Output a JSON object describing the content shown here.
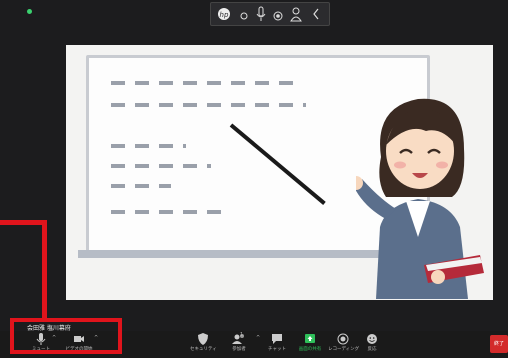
{
  "meeting": {
    "participant_name": "会田雅 塩川幕府",
    "end_label": "終了"
  },
  "toolbar": {
    "mute_label": "ミュート",
    "video_label": "ビデオの開始",
    "security_label": "セキュリティ",
    "participants_label": "参加者",
    "participants_count": "1",
    "chat_label": "チャット",
    "share_label": "画面の共有",
    "record_label": "レコーディング",
    "reactions_label": "反応"
  },
  "colors": {
    "annotation": "#e0141c",
    "share_green": "#2fbf5a",
    "end_red": "#d32b2b"
  },
  "icons": {
    "top": [
      "hp-logo-icon",
      "dot-icon",
      "mic-stand-icon",
      "target-icon",
      "person-icon",
      "chevron-left-icon"
    ]
  }
}
